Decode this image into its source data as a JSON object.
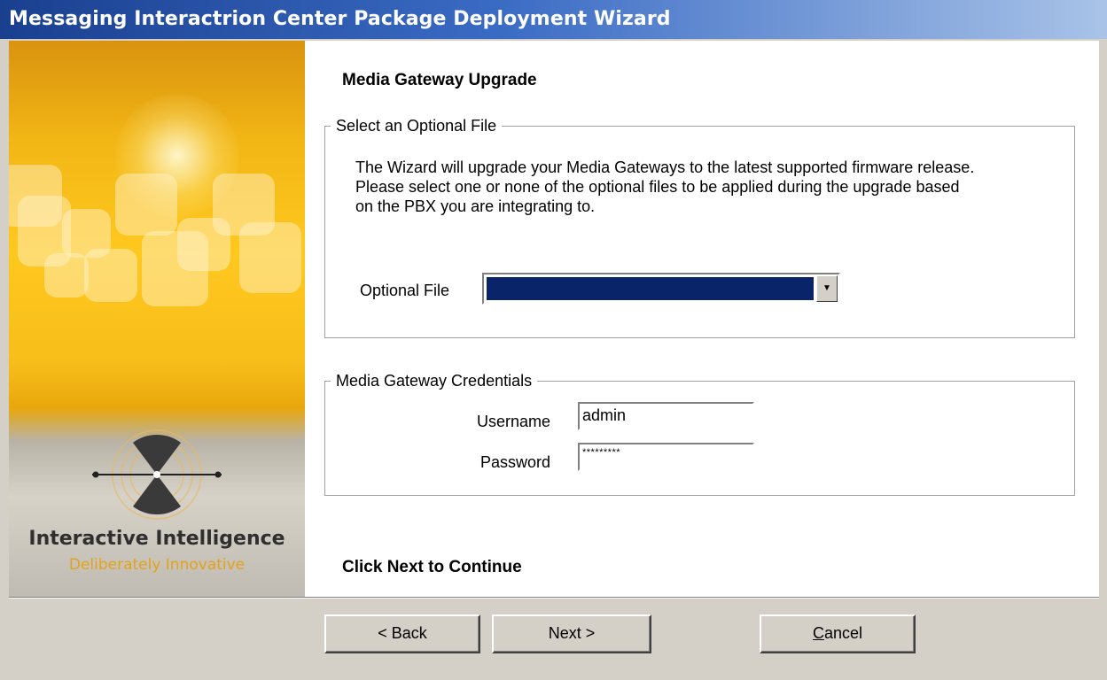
{
  "window": {
    "title": "Messaging Interactrion Center Package Deployment Wizard"
  },
  "branding": {
    "company": "Interactive Intelligence",
    "tagline": "Deliberately Innovative"
  },
  "page": {
    "heading": "Media Gateway Upgrade",
    "footer_hint": "Click Next to Continue"
  },
  "optional_file_group": {
    "legend": "Select an Optional File",
    "description": "The Wizard will upgrade your Media Gateways to the latest supported firmware release.  Please select one or none of the optional files to be applied during the upgrade based on the PBX you are integrating to.",
    "label": "Optional File",
    "selected_value": ""
  },
  "credentials_group": {
    "legend": "Media Gateway Credentials",
    "username_label": "Username",
    "username_value": "admin",
    "password_label": "Password",
    "password_value": "*********"
  },
  "buttons": {
    "back": "< Back",
    "next": "Next >",
    "cancel_prefix": "C",
    "cancel_rest": "ancel"
  },
  "colors": {
    "title_start": "#1a3f8f",
    "selection": "#0a246a",
    "brand_orange": "#e3a21a"
  }
}
